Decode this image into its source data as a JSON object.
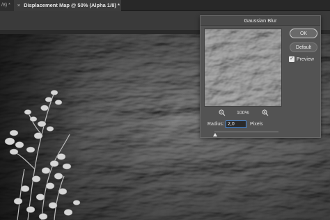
{
  "tabs": {
    "previous_label": "/8) *",
    "close_glyph": "×",
    "active_title": "Displacement Map @ 50% (Alpha 1/8) *"
  },
  "dialog": {
    "title": "Gaussian Blur",
    "ok_label": "OK",
    "default_label": "Default",
    "preview_label": "Preview",
    "preview_checked": true,
    "zoom_level": "100%",
    "radius_label": "Radius:",
    "radius_value": "2,0",
    "radius_unit": "Pixels"
  },
  "colors": {
    "accent": "#4a8fe0",
    "dialog_bg": "#535353",
    "canvas_bg": "#5a5a5a"
  },
  "icons": {
    "zoom_out": "zoom-out-icon",
    "zoom_in": "zoom-in-icon",
    "checkmark": "checkmark-icon"
  }
}
